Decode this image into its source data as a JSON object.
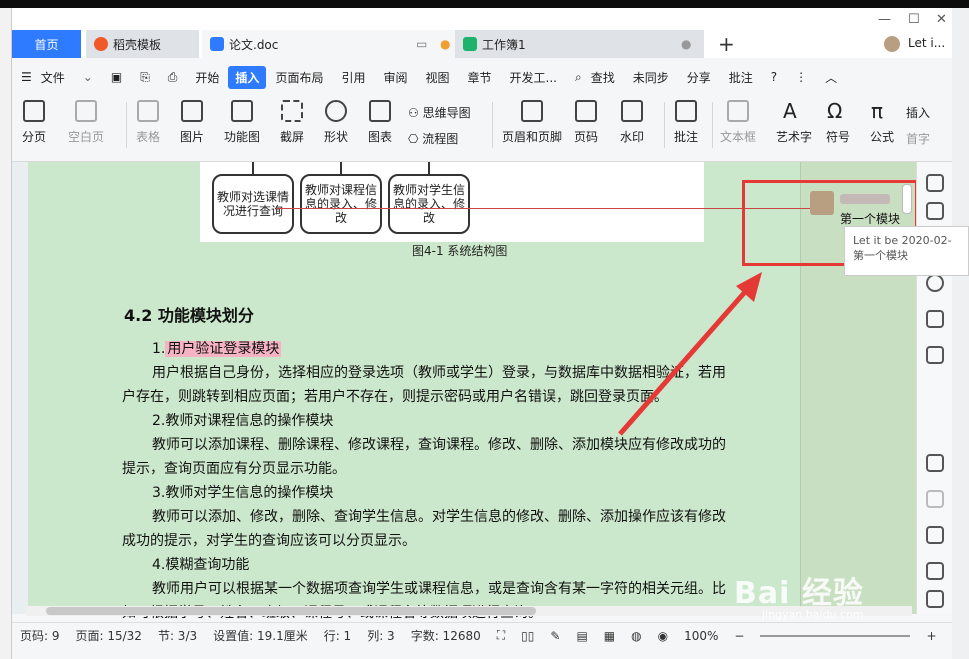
{
  "tabs": {
    "home": "首页",
    "daoke": "稻壳模板",
    "doc": "论文.doc",
    "sheet": "工作簿1",
    "new_tab": "+",
    "user": "Let i..."
  },
  "menu": {
    "file": "文件",
    "items": [
      "开始",
      "插入",
      "页面布局",
      "引用",
      "审阅",
      "视图",
      "章节",
      "开发工..."
    ],
    "search": "查找",
    "sync": "未同步",
    "share": "分享",
    "annotate": "批注"
  },
  "ribbon": {
    "page_break": "分页",
    "blank_page": "空白页",
    "table": "表格",
    "picture": "图片",
    "function_chart": "功能图",
    "screenshot": "截屏",
    "shape": "形状",
    "chart": "图表",
    "mindmap": "思维导图",
    "flowchart": "流程图",
    "header_footer": "页眉和页脚",
    "page_number": "页码",
    "watermark": "水印",
    "comment": "批注",
    "textbox": "文本框",
    "wordart": "艺术字",
    "symbol": "符号",
    "formula": "公式",
    "insert": "插入",
    "first_letter": "首字"
  },
  "figure": {
    "boxes": [
      "教师对选课情况进行查询",
      "教师对课程信息的录入、修改",
      "教师对学生信息的录入、修改"
    ],
    "caption": "图4-1  系统结构图"
  },
  "content": {
    "heading": "4.2  功能模块划分",
    "m1_prefix": "1.",
    "m1_title": "用户验证登录模块",
    "p1_l1": "用户根据自己身份，选择相应的登录选项（教师或学生）登录，与数据库中数据相验证，若用",
    "p1_l2": "户存在，则跳转到相应页面；若用户不存在，则提示密码或用户名错误，跳回登录页面。",
    "m2": "2.教师对课程信息的操作模块",
    "p2_l1": "教师可以添加课程、删除课程、修改课程，查询课程。修改、删除、添加模块应有修改成功的",
    "p2_l2": "提示，查询页面应有分页显示功能。",
    "m3": "3.教师对学生信息的操作模块",
    "p3_l1": "教师可以添加、修改，删除、查询学生信息。对学生信息的修改、删除、添加操作应该有修改",
    "p3_l2": "成功的提示，对学生的查询应该可以分页显示。",
    "m4": "4.模糊查询功能",
    "p4_l1": "教师用户可以根据某一个数据项查询学生或课程信息，或是查询含有某一字符的相关元组。比",
    "p4_l2": "如可根据学号、姓名、班级、课程号、或课程名等数据项进行查询。"
  },
  "comment": {
    "text": "第一个模块",
    "tooltip_l1": "Let it be 2020-02-",
    "tooltip_l2": "第一个模块"
  },
  "status": {
    "page_code": "页码: 9",
    "pages": "页面: 15/32",
    "section": "节: 3/3",
    "setting": "设置值: 19.1厘米",
    "row": "行: 1",
    "col": "列: 3",
    "words": "字数: 12680",
    "zoom": "100%"
  },
  "watermark": {
    "main": "Bai 经验",
    "sub": "jingyan.baidu.com"
  },
  "colors": {
    "accent": "#2f7bff",
    "doc_bg": "#cce8cc",
    "annotation_red": "#e53935",
    "highlight": "#f5b3c4"
  }
}
